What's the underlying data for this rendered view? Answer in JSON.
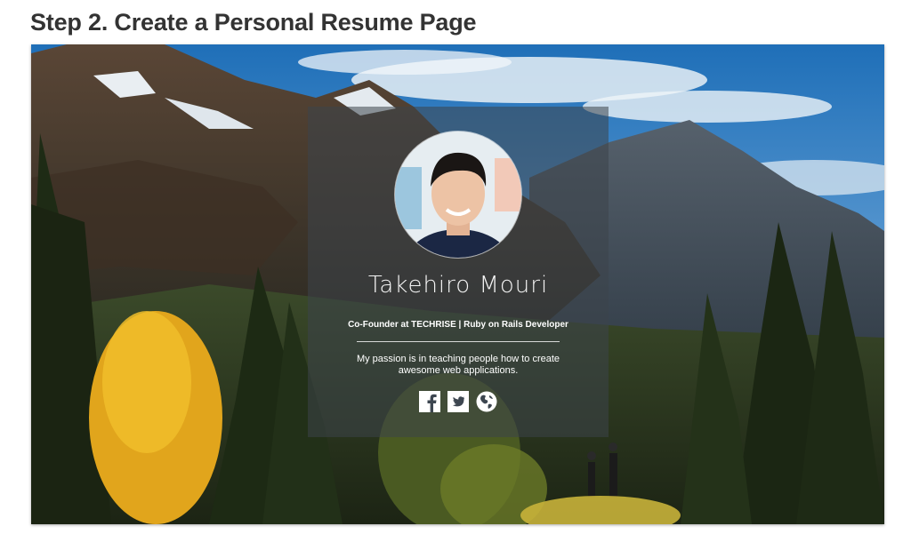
{
  "page": {
    "heading": "Step 2. Create a Personal Resume Page"
  },
  "profile": {
    "name": "Takehiro Mouri",
    "tagline": "Co-Founder at TECHRISE | Ruby on Rails Developer",
    "bio": "My passion is in teaching people how to create awesome web applications.",
    "avatar_alt": "Profile photo"
  },
  "social_links": [
    {
      "icon": "facebook-icon"
    },
    {
      "icon": "twitter-icon"
    },
    {
      "icon": "globe-icon"
    }
  ],
  "colors": {
    "heading": "#333333",
    "card_overlay": "rgba(60,68,74,0.55)",
    "text": "#ffffff",
    "sky": "#2f80c8"
  }
}
